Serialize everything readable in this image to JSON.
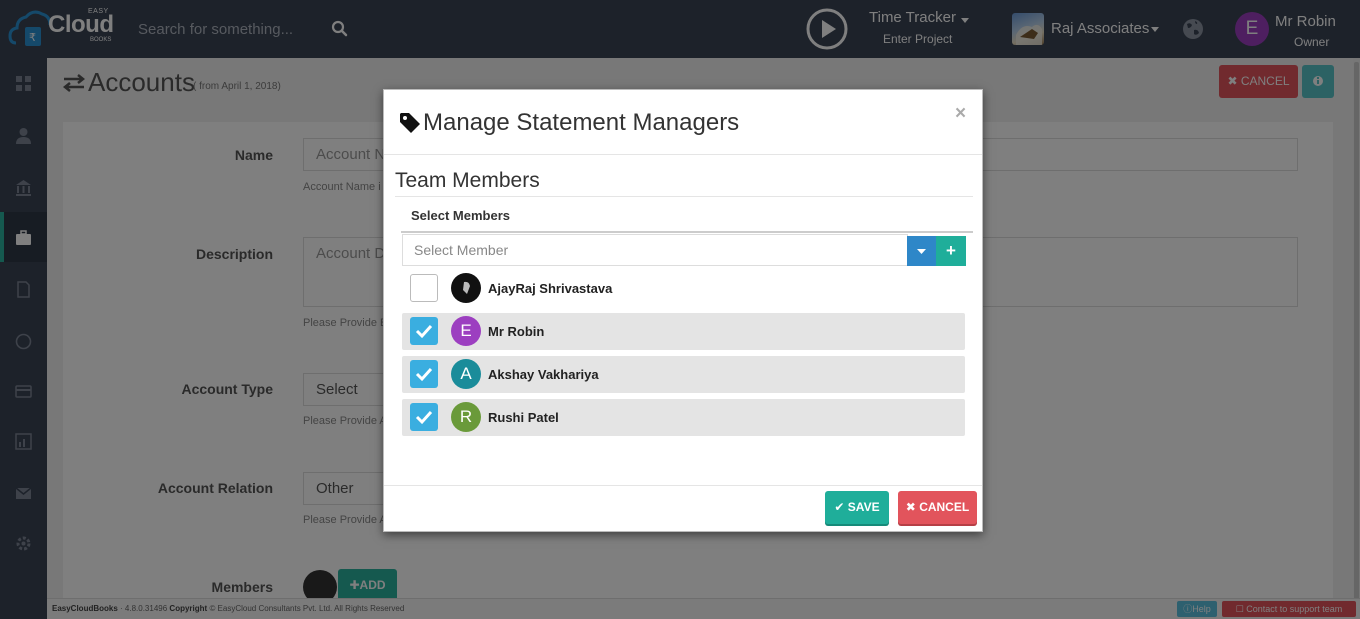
{
  "app": {
    "logo_easy": "EASY",
    "logo_cloud": "Cloud",
    "logo_books": "BOOKS"
  },
  "header": {
    "search_placeholder": "Search for something...",
    "time_tracker": "Time Tracker",
    "enter_project": "Enter Project",
    "company": "Raj Associates",
    "user_initial": "E",
    "user_name": "Mr Robin",
    "user_role": "Owner"
  },
  "page": {
    "title": "Accounts",
    "subtitle": "( from April 1, 2018)",
    "cancel_label": "CANCEL",
    "fields": [
      {
        "label": "Name",
        "placeholder": "Account N",
        "hint": "Account Name i"
      },
      {
        "label": "Description",
        "placeholder": "Account D",
        "hint": "Please Provide E"
      },
      {
        "label": "Account Type",
        "value": "Select",
        "hint": "Please Provide A"
      },
      {
        "label": "Account Relation",
        "value": "Other",
        "hint": "Please Provide A"
      },
      {
        "label": "Members",
        "add_label": "ADD"
      }
    ]
  },
  "footer": {
    "app_name": "EasyCloudBooks",
    "version": "· 4.8.0.31496",
    "copyright_label": "Copyright",
    "copyright_text": "© EasyCloud Consultants Pvt. Ltd. All Rights Reserved",
    "help_label": "Help",
    "contact_label": "Contact to support team"
  },
  "modal": {
    "title": "Manage Statement Managers",
    "close": "×",
    "section_title": "Team Members",
    "select_label": "Select Members",
    "select_placeholder": "Select Member",
    "plus_label": "+",
    "members": [
      {
        "name": "AjayRaj Shrivastava",
        "initial": "",
        "checked": false,
        "avatar_color": "#111111"
      },
      {
        "name": "Mr Robin",
        "initial": "E",
        "checked": true,
        "avatar_color": "#9c3fc0"
      },
      {
        "name": "Akshay Vakhariya",
        "initial": "A",
        "checked": true,
        "avatar_color": "#1a8c9a"
      },
      {
        "name": "Rushi Patel",
        "initial": "R",
        "checked": true,
        "avatar_color": "#6a9a3a"
      }
    ],
    "save_label": "SAVE",
    "cancel_label": "CANCEL"
  },
  "colors": {
    "nav_bg": "#3a4455",
    "accent_teal": "#1fae9a",
    "danger": "#e2545c",
    "checkbox_blue": "#3aaee0"
  }
}
